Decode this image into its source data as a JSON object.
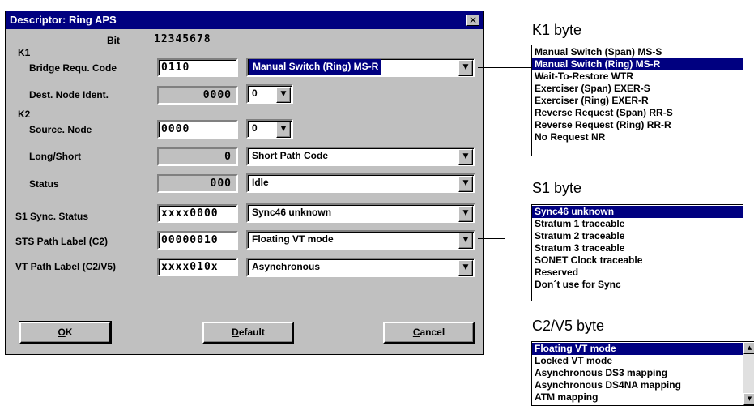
{
  "dialog": {
    "title": "Descriptor: Ring APS",
    "close_glyph": "✕",
    "bit_label": "Bit",
    "bit_numbers": "12345678",
    "k1_label": "K1",
    "k2_label": "K2",
    "rows": {
      "bridge": {
        "label": "Bridge Requ. Code",
        "value": "0110",
        "combo": "Manual Switch (Ring) MS-R"
      },
      "dest": {
        "label": "Dest. Node Ident.",
        "value": "0000",
        "combo": "0"
      },
      "source": {
        "label": "Source. Node",
        "value": "0000",
        "combo": "0"
      },
      "longshort": {
        "label": "Long/Short",
        "value": "0",
        "combo": "Short Path Code"
      },
      "status": {
        "label": "Status",
        "value": "000",
        "combo": "Idle"
      },
      "s1": {
        "label": "S1 Sync. Status",
        "value": "xxxx0000",
        "combo": "Sync46 unknown"
      },
      "c2": {
        "label_pre": "STS ",
        "label_u": "P",
        "label_post": "ath Label (C2)",
        "value": "00000010",
        "combo": "Floating VT mode"
      },
      "v5": {
        "label_u": "V",
        "label_post": "T Path Label (C2/V5)",
        "value": "xxxx010x",
        "combo": "Asynchronous"
      }
    },
    "buttons": {
      "ok": {
        "u": "O",
        "rest": "K"
      },
      "default": {
        "u": "D",
        "rest": "efault"
      },
      "cancel": {
        "u": "C",
        "rest": "ancel"
      }
    },
    "arrow_glyph": "▼"
  },
  "k1_panel": {
    "heading": "K1 byte",
    "items": [
      "Manual Switch (Span) MS-S",
      "Manual Switch (Ring) MS-R",
      "Wait-To-Restore WTR",
      "Exerciser (Span) EXER-S",
      "Exerciser (Ring) EXER-R",
      "Reverse Request (Span) RR-S",
      "Reverse Request (Ring) RR-R",
      "No Request NR"
    ],
    "selected_index": 1
  },
  "s1_panel": {
    "heading": "S1 byte",
    "items": [
      "Sync46 unknown",
      "Stratum 1 traceable",
      "Stratum 2 traceable",
      "Stratum 3 traceable",
      "SONET Clock traceable",
      "Reserved",
      "Don´t use for Sync"
    ],
    "selected_index": 0
  },
  "c2_panel": {
    "heading": "C2/V5 byte",
    "items": [
      "Floating VT mode",
      "Locked VT mode",
      "Asynchronous DS3 mapping",
      "Asynchronous DS4NA  mapping",
      "ATM mapping"
    ],
    "selected_index": 0,
    "scroll_up": "▲",
    "scroll_down": "▼"
  },
  "colors": {
    "selection": "#000080",
    "dialog_bg": "#c0c0c0"
  }
}
